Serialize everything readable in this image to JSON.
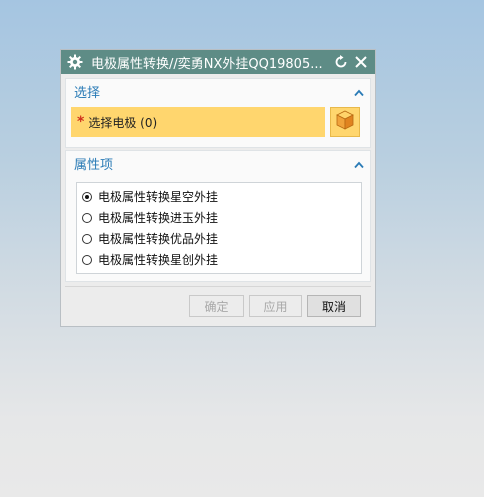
{
  "dialog": {
    "title": "电极属性转换//奕勇NX外挂QQ19805...",
    "icons": {
      "settings": "gear-icon",
      "reset": "refresh-icon",
      "close": "close-icon"
    }
  },
  "section_select": {
    "title": "选择",
    "collapse_icon": "chevron-up-icon",
    "required_mark": "*",
    "select_label": "选择电极 (0)",
    "select_button_icon": "cube-icon"
  },
  "section_attributes": {
    "title": "属性项",
    "collapse_icon": "chevron-up-icon",
    "options": [
      {
        "label": "电极属性转换星空外挂",
        "selected": true
      },
      {
        "label": "电极属性转换进玉外挂",
        "selected": false
      },
      {
        "label": "电极属性转换优品外挂",
        "selected": false
      },
      {
        "label": "电极属性转换星创外挂",
        "selected": false
      }
    ]
  },
  "buttons": {
    "ok": "确定",
    "apply": "应用",
    "cancel": "取消"
  },
  "colors": {
    "titlebar": "#5e8c86",
    "highlight": "#ffd66e",
    "section_title": "#2a7bb6"
  }
}
